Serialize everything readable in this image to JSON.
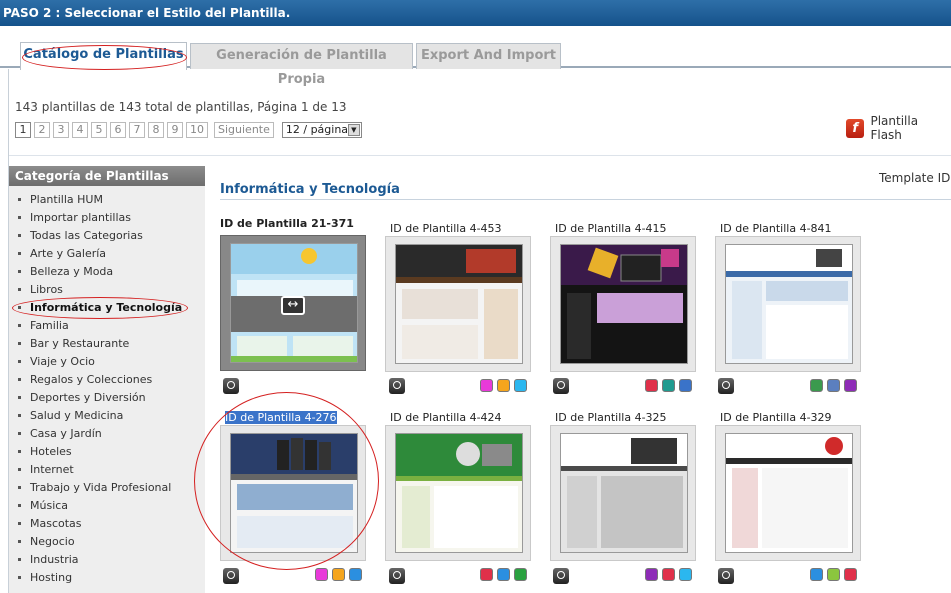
{
  "header": {
    "title": "PASO 2 : Seleccionar el Estilo del Plantilla."
  },
  "tabs": [
    {
      "label": "Catálogo de Plantillas",
      "active": true
    },
    {
      "label": "Generación de Plantilla Propia",
      "active": false
    },
    {
      "label": "Export And Import",
      "active": false
    }
  ],
  "summary": "143 plantillas de 143 total de plantillas, Página 1 de 13",
  "pager": {
    "pages": [
      "1",
      "2",
      "3",
      "4",
      "5",
      "6",
      "7",
      "8",
      "9",
      "10"
    ],
    "current": "1",
    "next_label": "Siguiente",
    "per_page": "12 / página"
  },
  "flash": {
    "label": "Plantilla Flash",
    "icon": "flash-icon"
  },
  "template_id_label": "Template ID",
  "sidebar": {
    "title": "Categoría de Plantillas",
    "items": [
      "Plantilla HUM",
      "Importar plantillas",
      "Todas las Categorias",
      "Arte y Galería",
      "Belleza y Moda",
      "Libros",
      "Informática y Tecnología",
      "Familia",
      "Bar y Restaurante",
      "Viaje y Ocio",
      "Regalos y Colecciones",
      "Deportes y Diversión",
      "Salud y Medicina",
      "Casa y Jardín",
      "Hoteles",
      "Internet",
      "Trabajo y Vida Profesional",
      "Música",
      "Mascotas",
      "Negocio",
      "Industria",
      "Hosting"
    ],
    "current": "Informática y Tecnología"
  },
  "category_title": "Informática y Tecnología",
  "templates": [
    {
      "title": "ID de Plantilla 21-371",
      "style": "bold",
      "hover": true,
      "swatches": []
    },
    {
      "title": "ID de Plantilla 4-453",
      "style": "normal",
      "hover": false,
      "swatches": [
        "#e83ad9",
        "#f5a51d",
        "#2bb7ef"
      ]
    },
    {
      "title": "ID de Plantilla 4-415",
      "style": "normal",
      "hover": false,
      "swatches": [
        "#e0304a",
        "#1f9b8f",
        "#3a73c9"
      ]
    },
    {
      "title": "ID de Plantilla 4-841",
      "style": "normal",
      "hover": false,
      "swatches": [
        "#3b9a4e",
        "#5b7fbf",
        "#8e2cb7"
      ]
    },
    {
      "title": "ID de Plantilla 4-276",
      "style": "highlight",
      "hover": false,
      "swatches": [
        "#e83ad9",
        "#f5a51d",
        "#2b8fe0"
      ]
    },
    {
      "title": "ID de Plantilla 4-424",
      "style": "normal",
      "hover": false,
      "swatches": [
        "#e0304a",
        "#2b8fe0",
        "#2aa140"
      ]
    },
    {
      "title": "ID de Plantilla 4-325",
      "style": "normal",
      "hover": false,
      "swatches": [
        "#8e2cb7",
        "#e0304a",
        "#2bb7ef"
      ]
    },
    {
      "title": "ID de Plantilla 4-329",
      "style": "normal",
      "hover": false,
      "swatches": [
        "#2b8fe0",
        "#8bc63e",
        "#e0304a"
      ]
    }
  ],
  "hover_icon": "resize-arrows-icon",
  "preview_icon": "magnifier-icon"
}
